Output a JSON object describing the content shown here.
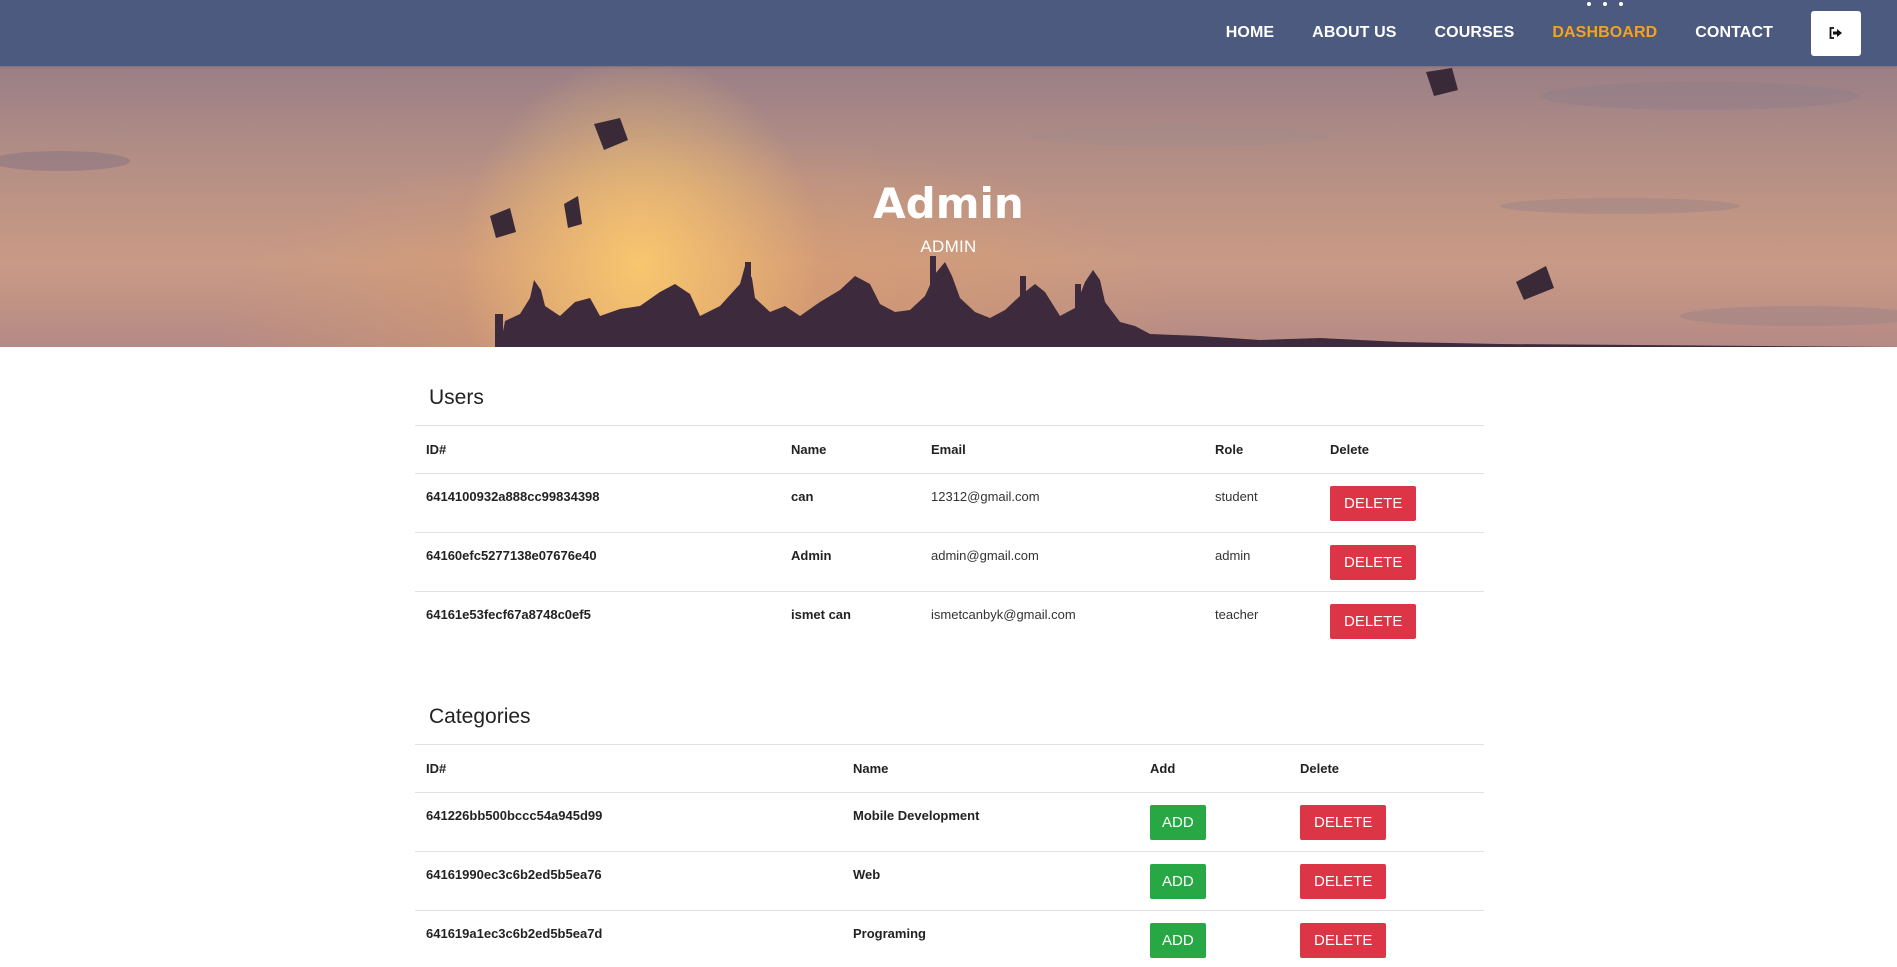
{
  "nav": {
    "links": [
      {
        "label": "HOME",
        "active": false
      },
      {
        "label": "ABOUT US",
        "active": false
      },
      {
        "label": "COURSES",
        "active": false
      },
      {
        "label": "DASHBOARD",
        "active": true
      },
      {
        "label": "CONTACT",
        "active": false
      }
    ],
    "logout_icon": "sign-out-icon"
  },
  "hero": {
    "title": "Admin",
    "subtitle": "ADMIN"
  },
  "users": {
    "title": "Users",
    "columns": [
      "ID#",
      "Name",
      "Email",
      "Role",
      "Delete"
    ],
    "rows": [
      {
        "id": "6414100932a888cc99834398",
        "name": "can",
        "email": "12312@gmail.com",
        "role": "student",
        "delete": "DELETE"
      },
      {
        "id": "64160efc5277138e07676e40",
        "name": "Admin",
        "email": "admin@gmail.com",
        "role": "admin",
        "delete": "DELETE"
      },
      {
        "id": "64161e53fecf67a8748c0ef5",
        "name": "ismet can",
        "email": "ismetcanbyk@gmail.com",
        "role": "teacher",
        "delete": "DELETE"
      }
    ]
  },
  "categories": {
    "title": "Categories",
    "columns": [
      "ID#",
      "Name",
      "Add",
      "Delete"
    ],
    "rows": [
      {
        "id": "641226bb500bccc54a945d99",
        "name": "Mobile Development",
        "add": "ADD",
        "delete": "DELETE"
      },
      {
        "id": "64161990ec3c6b2ed5b5ea76",
        "name": "Web",
        "add": "ADD",
        "delete": "DELETE"
      },
      {
        "id": "641619a1ec3c6b2ed5b5ea7d",
        "name": "Programing",
        "add": "ADD",
        "delete": "DELETE"
      }
    ]
  },
  "colors": {
    "navbar": "#4b5a7e",
    "active_nav": "#f7a21b",
    "delete": "#dc3545",
    "add": "#28a745"
  }
}
